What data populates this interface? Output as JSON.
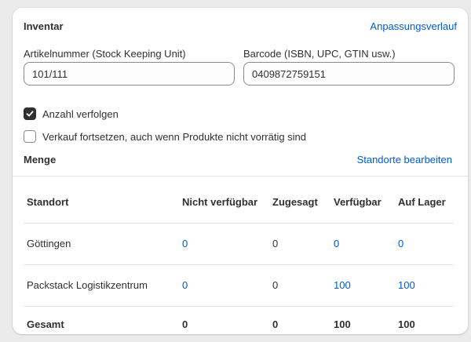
{
  "inventory": {
    "title": "Inventar",
    "history_link": "Anpassungsverlauf",
    "sku_label": "Artikelnummer (Stock Keeping Unit)",
    "sku_value": "101/111",
    "barcode_label": "Barcode (ISBN, UPC, GTIN usw.)",
    "barcode_value": "0409872759151",
    "track_quantity_label": "Anzahl verfolgen",
    "track_quantity_checked": true,
    "continue_selling_label": "Verkauf fortsetzen, auch wenn Produkte nicht vorrätig sind",
    "continue_selling_checked": false
  },
  "quantity": {
    "title": "Menge",
    "edit_locations_link": "Standorte bearbeiten",
    "columns": [
      "Standort",
      "Nicht verfügbar",
      "Zugesagt",
      "Verfügbar",
      "Auf Lager"
    ],
    "rows": [
      {
        "location": "Göttingen",
        "unavailable": "0",
        "committed": "0",
        "available": "0",
        "on_hand": "0"
      },
      {
        "location": "Packstack Logistikzentrum",
        "unavailable": "0",
        "committed": "0",
        "available": "100",
        "on_hand": "100"
      }
    ],
    "total": {
      "label": "Gesamt",
      "unavailable": "0",
      "committed": "0",
      "available": "100",
      "on_hand": "100"
    }
  },
  "colors": {
    "link": "#005bd3",
    "text": "#303030",
    "checkbox_checked": "#303030",
    "background": "#ebebeb"
  }
}
